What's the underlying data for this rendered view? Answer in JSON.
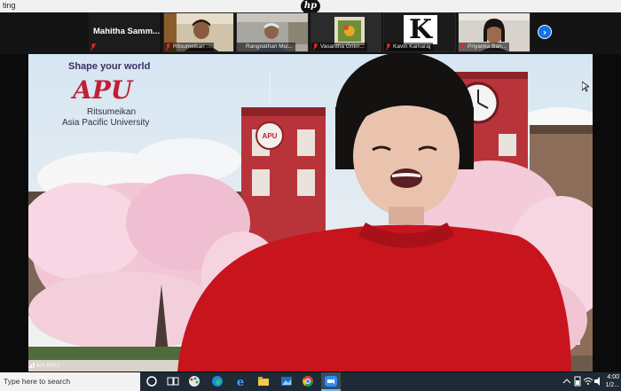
{
  "window": {
    "title": "ting"
  },
  "meeting": {
    "first_participant": "Mahitha  Samm...",
    "participants": [
      {
        "name": "Ritsumeikan ..."
      },
      {
        "name": "Rangnathan Mul..."
      },
      {
        "name": "Vasantha Grikri..."
      },
      {
        "name": "Kavin Kamaraj"
      },
      {
        "name": "Priyanka Ban..."
      }
    ],
    "avatar_letter": "K"
  },
  "background": {
    "tagline": "Shape your world",
    "logo_text": "APU",
    "university_line1": "Ritsumeikan",
    "university_line2": "Asia Pacific University",
    "building_badge": "APU"
  },
  "self_view_label": "AH APU",
  "taskbar": {
    "search_placeholder": "Type here to search",
    "time": "4:00",
    "date": "1/2..."
  },
  "colors": {
    "accent_blue": "#0e71eb",
    "apu_red": "#c11f35",
    "brick": "#b8343a",
    "sweater_red": "#c8141c"
  }
}
